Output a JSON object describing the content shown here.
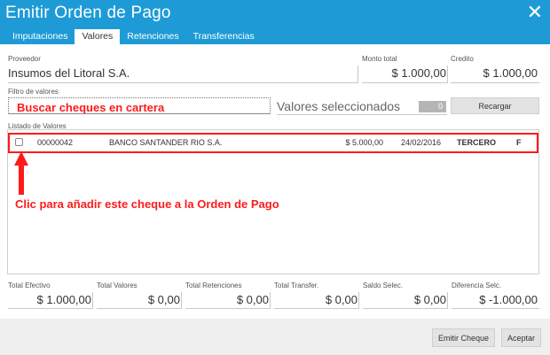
{
  "window": {
    "title": "Emitir Orden de Pago",
    "close": "✕"
  },
  "tabs": [
    {
      "label": "Imputaciones"
    },
    {
      "label": "Valores"
    },
    {
      "label": "Retenciones"
    },
    {
      "label": "Transferencias"
    }
  ],
  "header": {
    "proveedor_label": "Proveedor",
    "proveedor_value": "Insumos del Litoral S.A.",
    "monto_label": "Monto total",
    "monto_value": "$ 1.000,00",
    "credito_label": "Credito",
    "credito_value": "$ 1.000,00"
  },
  "filter": {
    "label": "Filtro de valores",
    "search_value": "",
    "annotation": "Buscar cheques en cartera",
    "selected_label": "Valores seleccionados",
    "selected_count": "0",
    "reload_button": "Recargar"
  },
  "list": {
    "label": "Listado de Valores",
    "rows": [
      {
        "number": "00000042",
        "bank": "BANCO SANTANDER RIO S.A.",
        "amount": "$ 5.000,00",
        "date": "24/02/2016",
        "type": "TERCERO",
        "flag": "F"
      }
    ],
    "annotation": "Clic para añadir este cheque a la Orden de Pago"
  },
  "totals": [
    {
      "label": "Total Efectivo",
      "value": "$ 1.000,00"
    },
    {
      "label": "Total Valores",
      "value": "$ 0,00"
    },
    {
      "label": "Total Retenciones",
      "value": "$ 0,00"
    },
    {
      "label": "Total Transfer.",
      "value": "$ 0,00"
    },
    {
      "label": "Saldo Selec.",
      "value": "$ 0,00"
    },
    {
      "label": "Diferencia Selc.",
      "value": "$ -1.000,00"
    }
  ],
  "footer": {
    "emit_button": "Emitir Cheque",
    "accept_button": "Aceptar"
  },
  "colors": {
    "titlebar": "#1e9bd7",
    "annotation": "#ff1a1a"
  }
}
